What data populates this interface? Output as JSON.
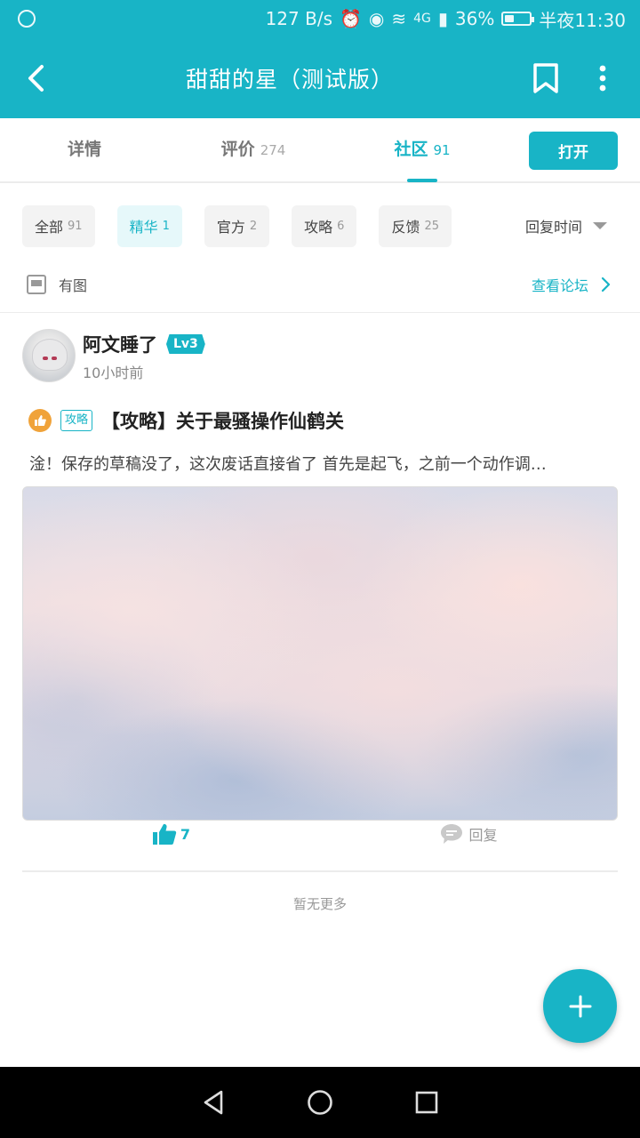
{
  "status_bar": {
    "speed": "127 B/s",
    "network": "4G",
    "battery": "36%",
    "battery_level": 0.36,
    "time": "半夜11:30"
  },
  "app_bar": {
    "title": "甜甜的星（测试版）"
  },
  "tabs": [
    {
      "label": "详情",
      "count": ""
    },
    {
      "label": "评价",
      "count": "274"
    },
    {
      "label": "社区",
      "count": "91",
      "active": true
    }
  ],
  "open_button": "打开",
  "filters": [
    {
      "label": "全部",
      "count": "91"
    },
    {
      "label": "精华",
      "count": "1",
      "active": true
    },
    {
      "label": "官方",
      "count": "2"
    },
    {
      "label": "攻略",
      "count": "6"
    },
    {
      "label": "反馈",
      "count": "25"
    }
  ],
  "sort": "回复时间",
  "has_pic": "有图",
  "forum_link": "查看论坛",
  "post": {
    "username": "阿文睡了",
    "level": "Lv3",
    "time": "10小时前",
    "tag": "攻略",
    "title": "【攻略】关于最骚操作仙鹤关",
    "excerpt": "淦！保存的草稿没了，这次废话直接省了  首先是起飞，之前一个动作调…",
    "likes": "7",
    "reply_label": "回复"
  },
  "no_more": "暂无更多",
  "colors": {
    "accent": "#18b4c6",
    "badge_orange": "#f0a33a"
  }
}
